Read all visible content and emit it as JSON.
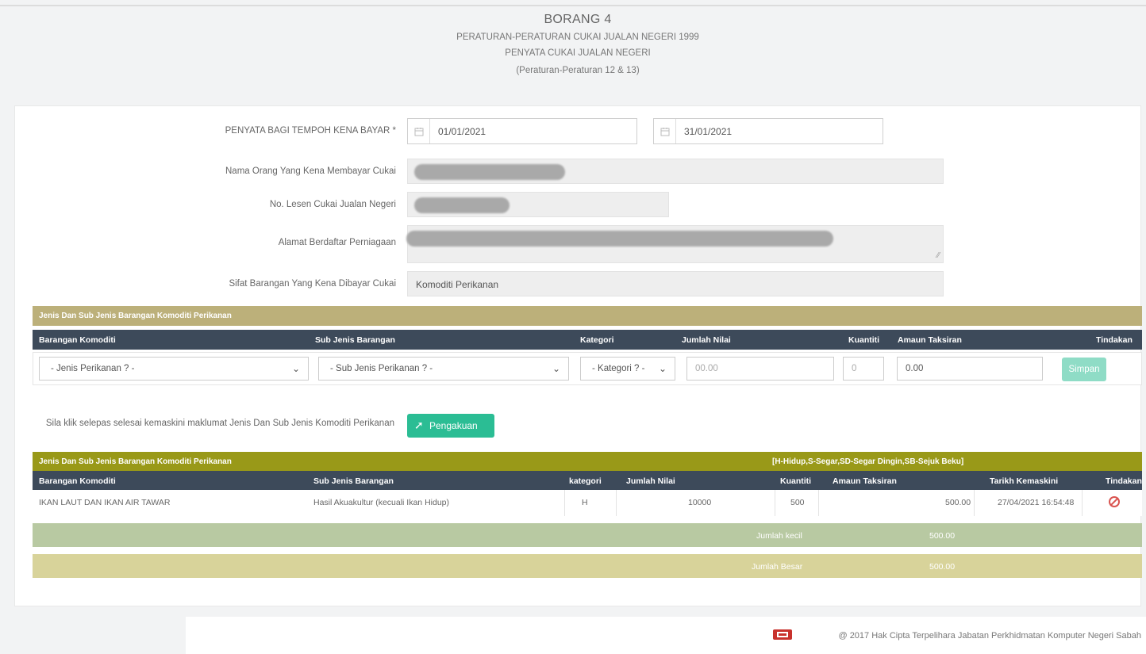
{
  "header": {
    "title": "BORANG 4",
    "line1": "PERATURAN-PERATURAN CUKAI JUALAN NEGERI 1999",
    "line2": "PENYATA CUKAI JUALAN NEGERI",
    "line3": "(Peraturan-Peraturan 12 & 13)"
  },
  "form": {
    "period_label": "PENYATA BAGI TEMPOH KENA BAYAR *",
    "date_from": "01/01/2021",
    "date_to": "31/01/2021",
    "name_label": "Nama Orang Yang Kena Membayar Cukai",
    "license_label": "No. Lesen Cukai Jualan Negeri",
    "address_label": "Alamat Berdaftar Perniagaan",
    "nature_label": "Sifat Barangan Yang Kena Dibayar Cukai",
    "nature_value": "Komoditi Perikanan"
  },
  "entry_table": {
    "section_title": "Jenis Dan Sub Jenis Barangan Komoditi Perikanan",
    "headers": [
      "Barangan Komoditi",
      "Sub Jenis Barangan",
      "Kategori",
      "Jumlah Nilai",
      "Kuantiti",
      "Amaun Taksiran",
      "Tindakan"
    ],
    "select_commodity": "- Jenis Perikanan ? -",
    "select_sub": "- Sub Jenis Perikanan ? -",
    "select_category": "- Kategori ? -",
    "jumlah_nilai_placeholder": "00.00",
    "kuantiti_placeholder": "0",
    "amaun_value": "0.00",
    "save_label": "Simpan"
  },
  "note": "Sila klik selepas selesai kemaskini maklumat Jenis Dan Sub Jenis Komoditi Perikanan",
  "pengakuan_label": "Pengakuan",
  "list_table": {
    "section_title": "Jenis Dan Sub Jenis Barangan Komoditi Perikanan",
    "legend": "[H-Hidup,S-Segar,SD-Segar Dingin,SB-Sejuk Beku]",
    "headers": [
      "Barangan Komoditi",
      "Sub Jenis Barangan",
      "kategori",
      "Jumlah Nilai",
      "Kuantiti",
      "Amaun Taksiran",
      "Tarikh Kemaskini",
      "Tindakan"
    ],
    "row": {
      "commodity": "IKAN LAUT DAN IKAN AIR TAWAR",
      "sub": "Hasil Akuakultur (kecuali Ikan Hidup)",
      "category": "H",
      "jumlah_nilai": "10000",
      "kuantiti": "500",
      "amaun": "500.00",
      "date": "27/04/2021 16:54:48"
    },
    "subtotal_label": "Jumlah kecil",
    "subtotal_value": "500.00",
    "total_label": "Jumlah Besar",
    "total_value": "500.00"
  },
  "footer": {
    "text": "@ 2017 Hak Cipta Terpelihara Jabatan Perkhidmatan Komputer Negeri Sabah"
  },
  "colors": {
    "section_bar": "#bcb07a",
    "section_bar2": "#999918",
    "header_dark": "#3d4a5a",
    "accent_green": "#2bbd94",
    "cancel_red": "#d9534f"
  }
}
